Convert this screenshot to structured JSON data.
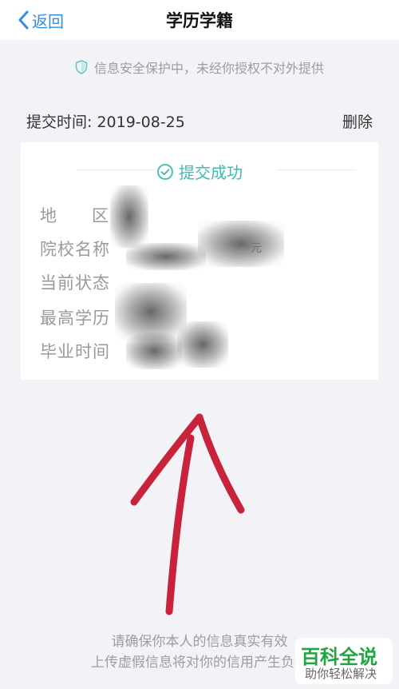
{
  "nav": {
    "back_label": "返回",
    "title": "学历学籍"
  },
  "notice": {
    "text": "信息安全保护中，未经你授权不对外提供"
  },
  "record": {
    "submit_time": "提交时间: 2019-08-25",
    "delete_label": "删除",
    "status": "提交成功",
    "fields": {
      "region": "地区",
      "school": "院校名称",
      "current_status": "当前状态",
      "highest_degree": "最高学历",
      "graduation_time": "毕业时间"
    },
    "redacted_fragment": "元"
  },
  "footer": {
    "line1": "请确保你本人的信息真实有效",
    "line2": "上传虚假信息将对你的信用产生负面"
  },
  "watermark": {
    "main": "百科全说",
    "sub": "助你轻松解决"
  },
  "colors": {
    "link_blue": "#2f8fe8",
    "success_teal": "#3cbcb1",
    "arrow_red": "#c8233b",
    "watermark_green": "#23a443"
  },
  "icons": {
    "back": "chevron-left-icon",
    "shield": "shield-icon",
    "success": "check-circle-icon",
    "annotation": "red-arrow-annotation"
  }
}
